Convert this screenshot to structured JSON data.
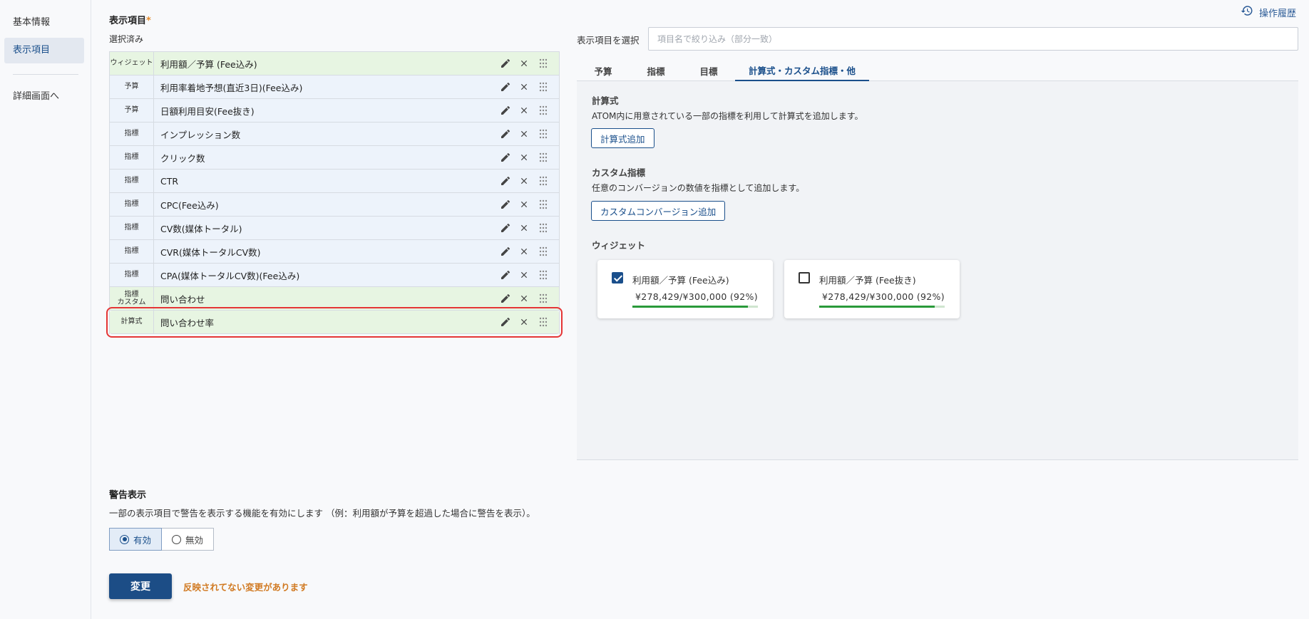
{
  "sidebar": {
    "items": [
      {
        "label": "基本情報"
      },
      {
        "label": "表示項目"
      },
      {
        "label": "詳細画面へ"
      }
    ]
  },
  "header": {
    "history_label": "操作履歴"
  },
  "display_items": {
    "title": "表示項目",
    "required_mark": "*",
    "selected_label": "選択済み",
    "rows": [
      {
        "tag": "ウィジェット",
        "label": "利用額／予算 (Fee込み)"
      },
      {
        "tag": "予算",
        "label": "利用率着地予想(直近3日)(Fee込み)"
      },
      {
        "tag": "予算",
        "label": "日額利用目安(Fee抜き)"
      },
      {
        "tag": "指標",
        "label": "インプレッション数"
      },
      {
        "tag": "指標",
        "label": "クリック数"
      },
      {
        "tag": "指標",
        "label": "CTR"
      },
      {
        "tag": "指標",
        "label": "CPC(Fee込み)"
      },
      {
        "tag": "指標",
        "label": "CV数(媒体トータル)"
      },
      {
        "tag": "指標",
        "label": "CVR(媒体トータルCV数)"
      },
      {
        "tag": "指標",
        "label": "CPA(媒体トータルCV数)(Fee込み)"
      },
      {
        "tag": "指標\nカスタム",
        "label": "問い合わせ"
      },
      {
        "tag": "計算式",
        "label": "問い合わせ率"
      }
    ]
  },
  "warning": {
    "title": "警告表示",
    "description": "一部の表示項目で警告を表示する機能を有効にします （例：利用額が予算を超過した場合に警告を表示）。",
    "options": [
      {
        "label": "有効",
        "selected": true
      },
      {
        "label": "無効",
        "selected": false
      }
    ]
  },
  "actions": {
    "submit_label": "変更",
    "unsaved_notice": "反映されてない変更があります"
  },
  "picker": {
    "label": "表示項目を選択",
    "placeholder": "項目名で絞り込み（部分一致）",
    "tabs": [
      {
        "label": "予算"
      },
      {
        "label": "指標"
      },
      {
        "label": "目標"
      },
      {
        "label": "計算式・カスタム指標・他",
        "active": true
      }
    ],
    "formula": {
      "title": "計算式",
      "description": "ATOM内に用意されている一部の指標を利用して計算式を追加します。",
      "button": "計算式追加"
    },
    "custom": {
      "title": "カスタム指標",
      "description": "任意のコンバージョンの数値を指標として追加します。",
      "button": "カスタムコンバージョン追加"
    },
    "widget": {
      "title": "ウィジェット",
      "cards": [
        {
          "label": "利用額／予算 (Fee込み)",
          "value": "¥278,429/¥300,000 (92%)",
          "checked": true,
          "progress": 0.92
        },
        {
          "label": "利用額／予算 (Fee抜き)",
          "value": "¥278,429/¥300,000 (92%)",
          "checked": false,
          "progress": 0.92
        }
      ]
    }
  },
  "colors": {
    "accent": "#1a4f8b",
    "widget_row_bg": "#e7f5e2",
    "metric_row_bg": "#edf3fb",
    "highlight_border": "#e53535",
    "progress_fill": "#2a9a3a",
    "unsaved_text": "#d17a22"
  }
}
